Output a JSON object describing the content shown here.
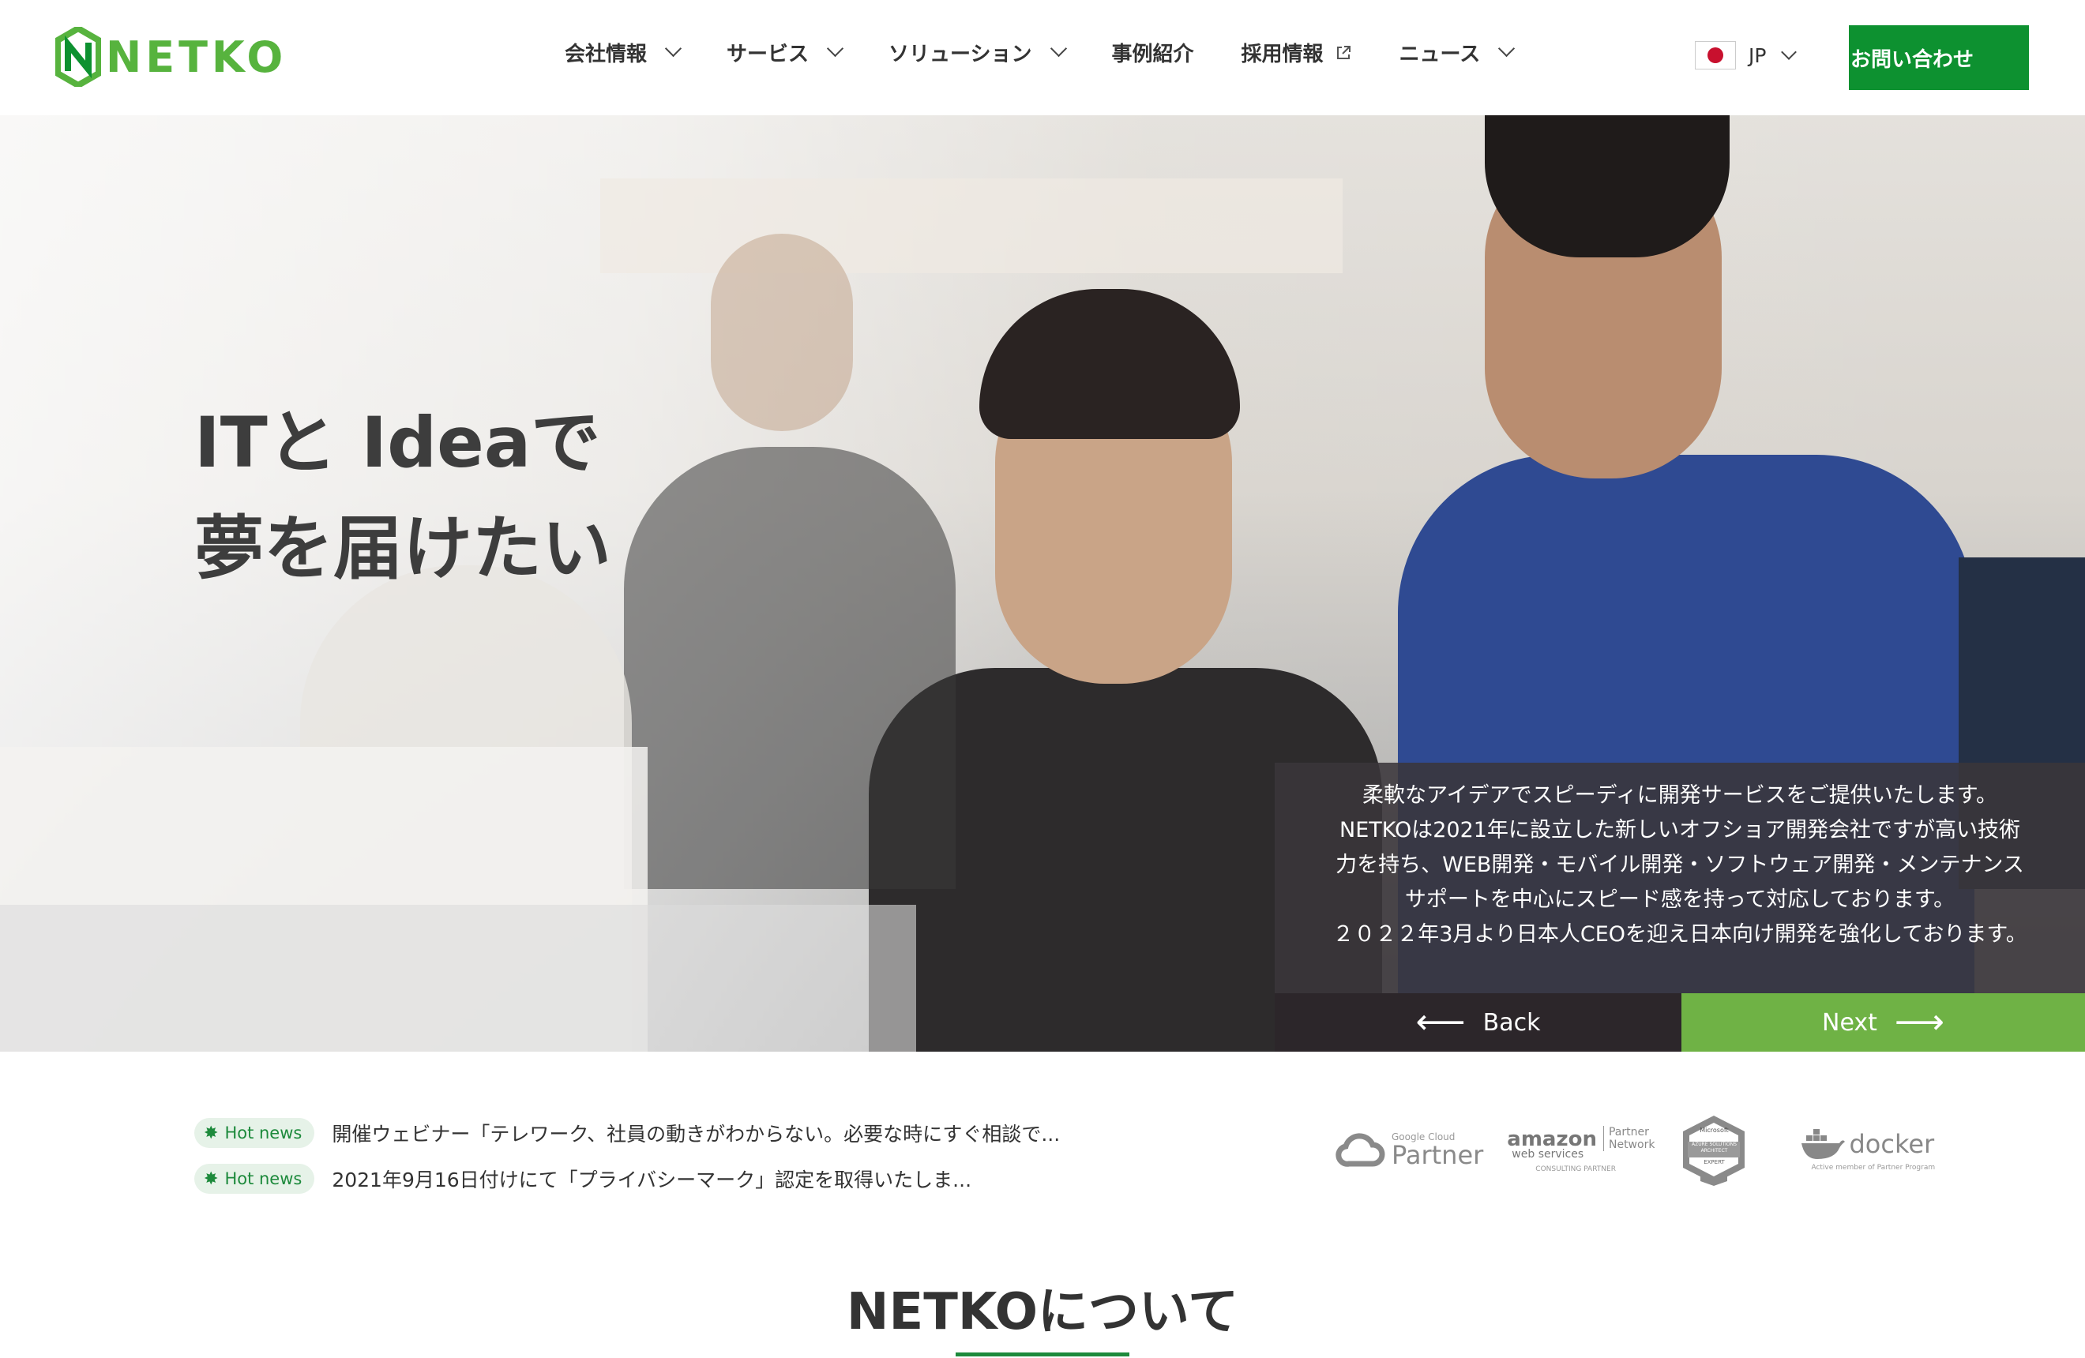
{
  "header": {
    "logo_text": "NETKO",
    "nav": [
      {
        "label": "会社情報"
      },
      {
        "label": "サービス"
      },
      {
        "label": "ソリューション"
      },
      {
        "label": "事例紹介"
      },
      {
        "label": "採用情報"
      },
      {
        "label": "ニュース"
      }
    ],
    "language": "JP",
    "contact_label": "お問い合わせ"
  },
  "hero": {
    "title_line1": "ITと Ideaで",
    "title_line2": "夢を届けたい",
    "info_lines": [
      "柔軟なアイデアでスピーディに開発サービスをご提供いたします。",
      "NETKOは2021年に設立した新しいオフショア開発会社ですが高い技術",
      "力を持ち、WEB開発・モバイル開発・ソフトウェア開発・メンテナンス",
      "サポートを中心にスピード感を持って対応しております。",
      "２０２２年3月より日本人CEOを迎え日本向け開発を強化しております。"
    ],
    "back_label": "Back",
    "next_label": "Next"
  },
  "news": [
    {
      "badge": "Hot news",
      "text": "開催ウェビナー「テレワーク、社員の動きがわからない。必要な時にすぐ相談で..."
    },
    {
      "badge": "Hot news",
      "text": "2021年9月16日付けにて「プライバシーマーク」認定を取得いたしま..."
    }
  ],
  "partners": {
    "google_small": "Google Cloud",
    "google_big": "Partner",
    "amazon_main": "amazon",
    "amazon_sub": "web services",
    "amazon_partner": "Partner",
    "amazon_network": "Network",
    "amazon_consult": "CONSULTING PARTNER",
    "ms_top": "Microsoft",
    "ms_badge": "AZURE SOLUTIONS ARCHITECT",
    "ms_bottom": "EXPERT",
    "docker_name": "docker",
    "docker_sub": "Active member of Partner Program"
  },
  "about": {
    "title": "NETKOについて"
  },
  "colors": {
    "brand_green": "#57b33e",
    "contact_green": "#0d9130",
    "next_green": "#6fb245",
    "back_dark": "#2c262a"
  }
}
